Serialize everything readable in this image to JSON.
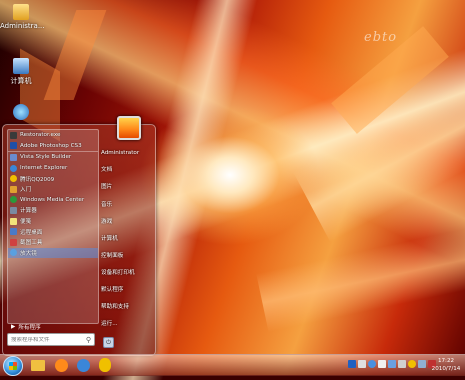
{
  "desktop": {
    "logo_text": "ebto",
    "icons": [
      {
        "label": "Administra..."
      },
      {
        "label": "计算机"
      },
      {
        "label": ""
      }
    ]
  },
  "start_menu": {
    "programs": [
      {
        "label": "Restorator.exe",
        "icon": "app-icon",
        "color": "#3a3a3a"
      },
      {
        "label": "Adobe Photoshop CS3",
        "icon": "photoshop-icon",
        "color": "#1f4fa8"
      },
      {
        "label": "Vista Style Builder",
        "icon": "app-icon",
        "color": "#6a8bd0"
      },
      {
        "label": "Internet Explorer",
        "icon": "ie-icon",
        "color": "#3b86d8"
      },
      {
        "label": "腾讯QQ2009",
        "icon": "qq-icon",
        "color": "#f0c000"
      },
      {
        "label": "入门",
        "icon": "getting-started-icon",
        "color": "#e0a030"
      },
      {
        "label": "Windows Media Center",
        "icon": "media-center-icon",
        "color": "#2a9a3a"
      },
      {
        "label": "计算器",
        "icon": "calculator-icon",
        "color": "#7a8aa0"
      },
      {
        "label": "便笺",
        "icon": "sticky-notes-icon",
        "color": "#f2e27a"
      },
      {
        "label": "远程桌面",
        "icon": "remote-desktop-icon",
        "color": "#4a7ac8"
      },
      {
        "label": "截图工具",
        "icon": "snipping-tool-icon",
        "color": "#d04040"
      },
      {
        "label": "放大镜",
        "icon": "magnifier-icon",
        "color": "#5aa0e0"
      }
    ],
    "selected_index": 11,
    "all_programs_label": "所有程序",
    "search_placeholder": "搜索程序和文件",
    "user_name": "Administrator",
    "right_links": [
      "文档",
      "图片",
      "音乐",
      "游戏",
      "计算机",
      "控制面板",
      "设备和打印机",
      "默认程序",
      "帮助和支持",
      "运行..."
    ]
  },
  "taskbar": {
    "pinned": [
      {
        "icon": "explorer-icon",
        "color": "#f0c040"
      },
      {
        "icon": "media-player-icon",
        "color": "#ff8a1a"
      },
      {
        "icon": "ie-icon",
        "color": "#3b86d8"
      },
      {
        "icon": "qq-icon",
        "color": "#f0c000"
      }
    ],
    "tray_icons": [
      {
        "icon": "chinese-input-icon",
        "color": "#2060c0"
      },
      {
        "icon": "keyboard-icon",
        "color": "#e0e0e0"
      },
      {
        "icon": "help-icon",
        "color": "#4a90e0"
      },
      {
        "icon": "flag-icon",
        "color": "#f0f0f0"
      },
      {
        "icon": "network-icon",
        "color": "#6aa0e0"
      },
      {
        "icon": "volume-icon",
        "color": "#d0d0d0"
      },
      {
        "icon": "qq-tray-icon",
        "color": "#f0c000"
      },
      {
        "icon": "monitor-icon",
        "color": "#90b0d0"
      },
      {
        "icon": "security-icon",
        "color": "#c03030"
      }
    ],
    "clock_time": "17:22",
    "clock_date": "2010/7/14"
  }
}
